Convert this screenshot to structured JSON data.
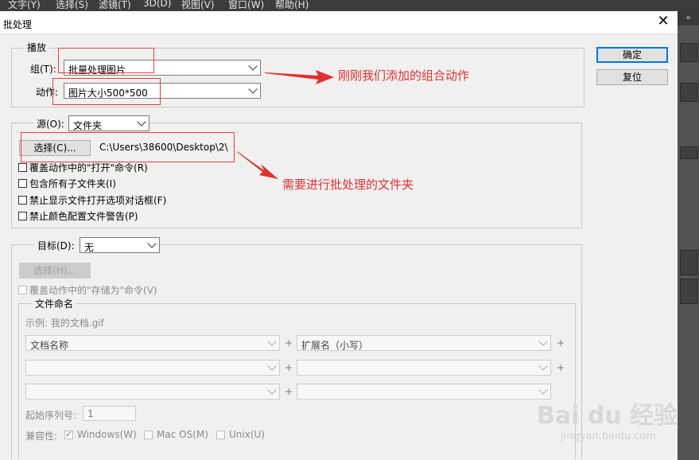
{
  "menubar": {
    "items": [
      "文字(Y)",
      "选择(S)",
      "滤镜(T)",
      "3D(D)",
      "视图(V)",
      "窗口(W)",
      "帮助(H)"
    ]
  },
  "dialog": {
    "title": "批处理",
    "close_glyph": "✕",
    "ok_label": "确定",
    "reset_label": "复位"
  },
  "play": {
    "legend": "播放",
    "group_label": "组(T):",
    "group_value": "批量处理图片",
    "action_label": "动作:",
    "action_value": "图片大小500*500"
  },
  "source": {
    "label": "源(O):",
    "value": "文件夹",
    "choose_label": "选择(C)...",
    "path": "C:\\Users\\38600\\Desktop\\2\\",
    "options": [
      "覆盖动作中的\"打开\"命令(R)",
      "包含所有子文件夹(I)",
      "禁止显示文件打开选项对话框(F)",
      "禁止颜色配置文件警告(P)"
    ]
  },
  "target": {
    "label": "目标(D):",
    "value": "无",
    "choose_label": "选择(H)...",
    "override_label": "覆盖动作中的\"存储为\"命令(V)"
  },
  "naming": {
    "legend": "文件命名",
    "example": "示例: 我的文档.gif",
    "field1": "文档名称",
    "field2": "扩展名（小写）",
    "plus": "+",
    "serial_label": "起始序列号:",
    "serial_value": "1",
    "compat_label": "兼容性:",
    "windows": "Windows(W)",
    "macos": "Mac OS(M)",
    "unix": "Unix(U)"
  },
  "annotations": {
    "note1": "刚刚我们添加的组合动作",
    "note2": "需要进行批处理的文件夹",
    "color": "#e23030"
  },
  "watermark": {
    "brand": "Bai du 经验",
    "url": "jingyan.baidu.com"
  },
  "side_panel": {
    "tab": "«"
  }
}
